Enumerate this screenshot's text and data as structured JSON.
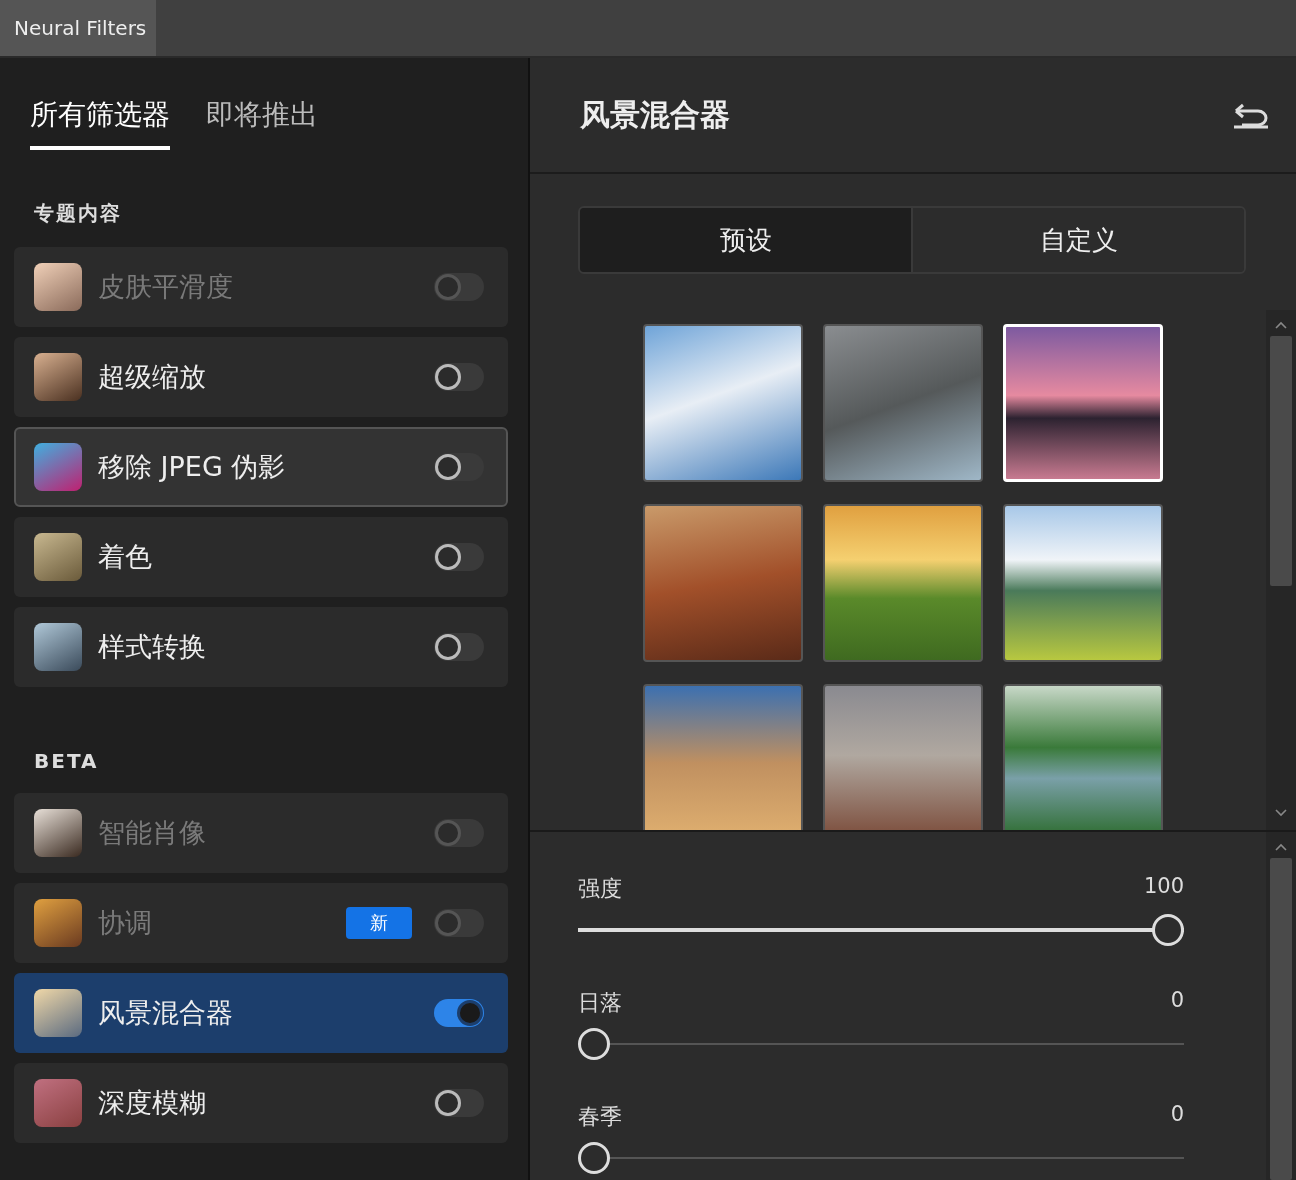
{
  "window": {
    "title": "Neural Filters"
  },
  "tabs": [
    {
      "label": "所有筛选器",
      "selected": true
    },
    {
      "label": "即将推出",
      "selected": false
    }
  ],
  "sections": [
    {
      "heading": "专题内容",
      "filters": [
        {
          "name": "皮肤平滑度",
          "disabled": true,
          "on": false,
          "selected": false,
          "hovered": false
        },
        {
          "name": "超级缩放",
          "disabled": false,
          "on": false,
          "selected": false,
          "hovered": false
        },
        {
          "name": "移除 JPEG 伪影",
          "disabled": false,
          "on": false,
          "selected": false,
          "hovered": true
        },
        {
          "name": "着色",
          "disabled": false,
          "on": false,
          "selected": false,
          "hovered": false
        },
        {
          "name": "样式转换",
          "disabled": false,
          "on": false,
          "selected": false,
          "hovered": false
        }
      ]
    },
    {
      "heading": "BETA",
      "filters": [
        {
          "name": "智能肖像",
          "disabled": true,
          "on": false,
          "selected": false,
          "hovered": false
        },
        {
          "name": "协调",
          "disabled": true,
          "on": false,
          "selected": false,
          "hovered": false,
          "badge": "新"
        },
        {
          "name": "风景混合器",
          "disabled": false,
          "on": true,
          "selected": true,
          "hovered": false
        },
        {
          "name": "深度模糊",
          "disabled": false,
          "on": false,
          "selected": false,
          "hovered": false
        }
      ]
    }
  ],
  "detail": {
    "title": "风景混合器",
    "modes": [
      {
        "label": "预设",
        "selected": true
      },
      {
        "label": "自定义",
        "selected": false
      }
    ],
    "presets": [
      {
        "selected": false
      },
      {
        "selected": false
      },
      {
        "selected": true
      },
      {
        "selected": false
      },
      {
        "selected": false
      },
      {
        "selected": false
      },
      {
        "selected": false
      },
      {
        "selected": false
      },
      {
        "selected": false
      }
    ],
    "sliders": [
      {
        "label": "强度",
        "reading": "100",
        "level": 1
      },
      {
        "label": "日落",
        "reading": "0",
        "level": 0
      },
      {
        "label": "春季",
        "reading": "0",
        "level": 0
      }
    ]
  }
}
